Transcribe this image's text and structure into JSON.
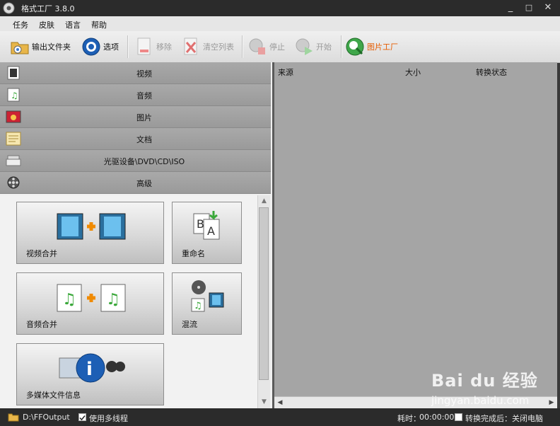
{
  "window": {
    "title": "格式工厂 3.8.0",
    "minimize": "_",
    "maximize": "□",
    "close": "✕"
  },
  "menu": [
    "任务",
    "皮肤",
    "语言",
    "帮助"
  ],
  "toolbar": {
    "output_folder": "输出文件夹",
    "options": "选项",
    "remove": "移除",
    "clear_list": "清空列表",
    "stop": "停止",
    "start": "开始",
    "picture_factory": "图片工厂"
  },
  "categories": [
    {
      "label": "视频",
      "icon": "film-icon"
    },
    {
      "label": "音频",
      "icon": "music-note-icon"
    },
    {
      "label": "图片",
      "icon": "picture-icon"
    },
    {
      "label": "文档",
      "icon": "document-icon"
    },
    {
      "label": "光驱设备\\DVD\\CD\\ISO",
      "icon": "optical-drive-icon"
    },
    {
      "label": "高级",
      "icon": "film-reel-icon"
    }
  ],
  "tiles": {
    "video_join": "视频合并",
    "rename": "重命名",
    "audio_join": "音频合并",
    "mux": "混流",
    "media_info": "多媒体文件信息"
  },
  "list_columns": {
    "source": "来源",
    "size": "大小",
    "status": "转换状态"
  },
  "status": {
    "folder": "D:\\FFOutput",
    "multithread": "使用多线程",
    "multithread_checked": true,
    "elapsed_label": "耗时：",
    "elapsed": "00:00:00",
    "after_done": "转换完成后：关闭电脑"
  },
  "watermark": {
    "brand": "Bai du 经验",
    "url": "jingyan.baidu.com"
  },
  "colors": {
    "accent_orange": "#e65c00",
    "bg_dark": "#2b2b2b"
  }
}
